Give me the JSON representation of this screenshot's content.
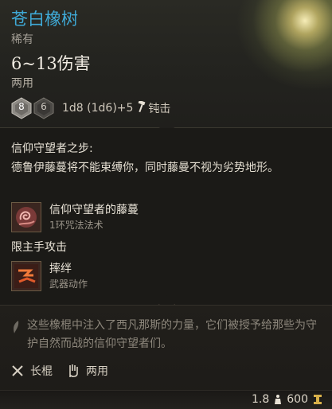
{
  "item": {
    "name": "苍白橡树",
    "rarity": "稀有",
    "damage": "6~13伤害",
    "handedness": "两用"
  },
  "dice": {
    "left_value": "8",
    "right_value": "6",
    "formula": "1d8 (1d6)+5",
    "damage_type": "钝击",
    "damage_type_icon": "hammer-icon"
  },
  "passive": {
    "title": "信仰守望者之步:",
    "description": "德鲁伊藤蔓将不能束缚你，同时藤曼不视为劣势地形。"
  },
  "abilities": [
    {
      "name": "信仰守望者的藤蔓",
      "subtitle": "1环咒法法术",
      "icon": "vine-spell-icon"
    },
    {
      "name": "摔绊",
      "subtitle": "武器动作",
      "icon": "topple-icon"
    }
  ],
  "offhand_label": "限主手攻击",
  "flavor_text": "这些橡棍中注入了西凡那斯的力量，它们被授予给那些为守护自然而战的信仰守望者们。",
  "tags": [
    {
      "label": "长棍",
      "icon": "crossed-staff-icon"
    },
    {
      "label": "两用",
      "icon": "hand-icon"
    }
  ],
  "stats": {
    "weight": "1.8",
    "value": "600",
    "weight_icon": "weight-icon",
    "value_icon": "gold-icon"
  },
  "colors": {
    "item_name": "#3fa9d6",
    "background": "#1b1a17"
  }
}
